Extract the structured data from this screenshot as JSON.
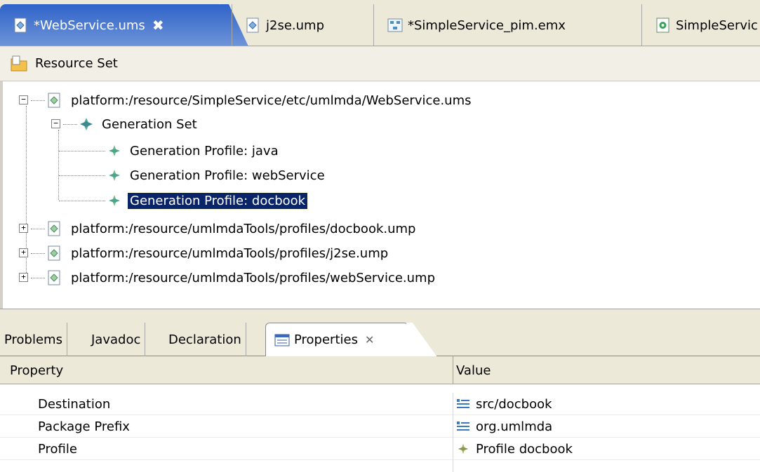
{
  "editor_tabs": [
    {
      "label": "*WebService.ums",
      "active": true
    },
    {
      "label": "j2se.ump",
      "active": false
    },
    {
      "label": "*SimpleService_pim.emx",
      "active": false
    },
    {
      "label": "SimpleServic",
      "active": false
    }
  ],
  "resource_set": {
    "title": "Resource Set"
  },
  "tree": {
    "root1": "platform:/resource/SimpleService/etc/umlmda/WebService.ums",
    "generation_set": "Generation Set",
    "profile_java": "Generation Profile: java",
    "profile_webservice": "Generation Profile: webService",
    "profile_docbook": "Generation Profile: docbook",
    "root2": "platform:/resource/umlmdaTools/profiles/docbook.ump",
    "root3": "platform:/resource/umlmdaTools/profiles/j2se.ump",
    "root4": "platform:/resource/umlmdaTools/profiles/webService.ump"
  },
  "view_tabs": {
    "problems": "Problems",
    "javadoc": "Javadoc",
    "declaration": "Declaration",
    "properties": "Properties",
    "close_glyph": "✕"
  },
  "properties_table": {
    "col_property": "Property",
    "col_value": "Value",
    "rows": [
      {
        "property": "Destination",
        "value": "src/docbook"
      },
      {
        "property": "Package Prefix",
        "value": "org.umlmda"
      },
      {
        "property": "Profile",
        "value": "Profile docbook"
      }
    ]
  },
  "close_tab_glyph": "✖",
  "colors": {
    "active_tab": "#2f63c9",
    "selection": "#0a246a",
    "profile_icon": "#4aa58a"
  }
}
